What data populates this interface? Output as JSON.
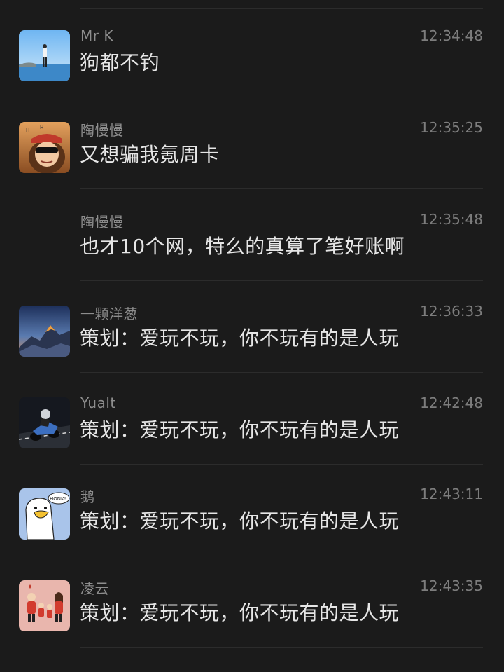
{
  "messages": [
    {
      "sender": "Mr  K",
      "time": "12:34:48",
      "text": "狗都不钓",
      "avatar": "person-at-sea-avatar"
    },
    {
      "sender": "陶慢慢",
      "time": "12:35:25",
      "text": "又想骗我氪周卡",
      "avatar": "cartoon-girl-sunglasses-avatar"
    },
    {
      "sender": "陶慢慢",
      "time": "12:35:48",
      "text": "也才10个网，特么的真算了笔好账啊",
      "avatar": ""
    },
    {
      "sender": "一颗洋葱",
      "time": "12:36:33",
      "text": "策划：爱玩不玩，你不玩有的是人玩",
      "avatar": "mountain-sunset-avatar"
    },
    {
      "sender": "Yualt",
      "time": "12:42:48",
      "text": "策划：爱玩不玩，你不玩有的是人玩",
      "avatar": "motorcycle-rider-avatar"
    },
    {
      "sender": "鹅",
      "time": "12:43:11",
      "text": "策划：爱玩不玩，你不玩有的是人玩",
      "avatar": "goose-honk-avatar",
      "avatar_text": "HONK!"
    },
    {
      "sender": "凌云",
      "time": "12:43:35",
      "text": "策划：爱玩不玩，你不玩有的是人玩",
      "avatar": "family-cartoon-avatar"
    }
  ]
}
